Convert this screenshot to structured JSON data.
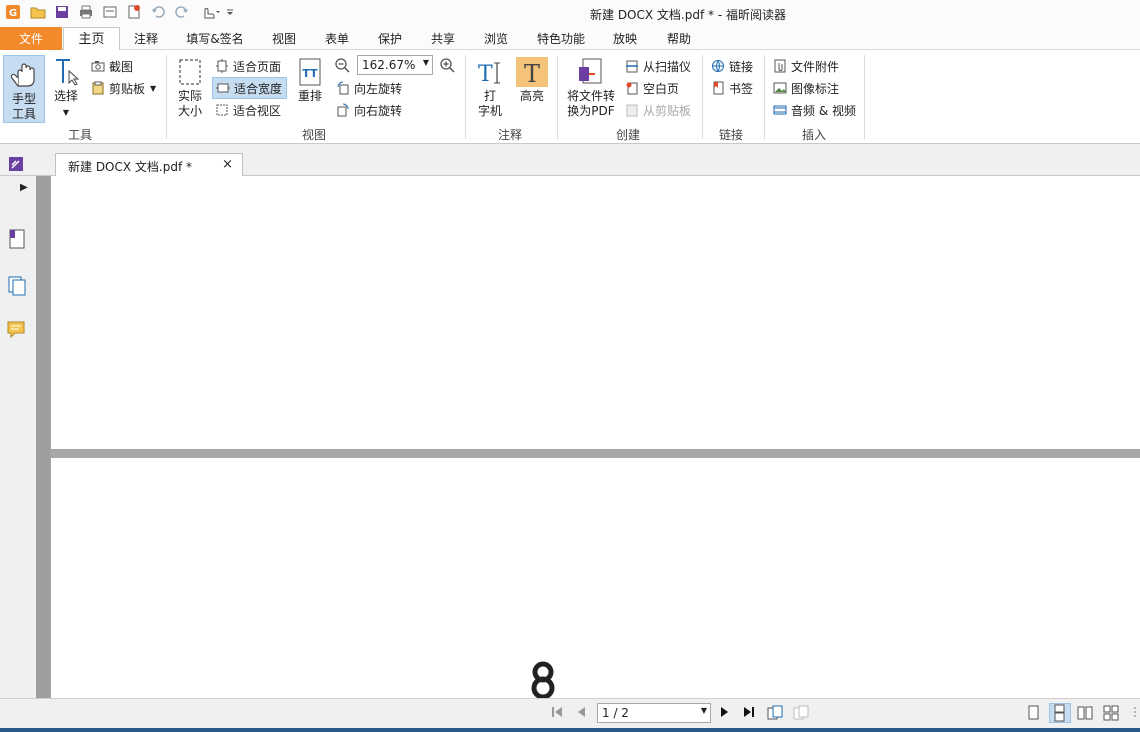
{
  "window": {
    "title": "新建 DOCX 文档.pdf * - 福昕阅读器"
  },
  "menubar": {
    "file": "文件",
    "home": "主页",
    "items": [
      "注释",
      "填写&签名",
      "视图",
      "表单",
      "保护",
      "共享",
      "浏览",
      "特色功能",
      "放映",
      "帮助"
    ]
  },
  "ribbon": {
    "tools": {
      "hand_tool": "手型工具",
      "hand_line1": "手型",
      "hand_line2": "工具",
      "select": "选择",
      "screenshot": "截图",
      "clipboard": "剪贴板",
      "group_label": "工具"
    },
    "view": {
      "actual_size_line1": "实际",
      "actual_size_line2": "大小",
      "fit_page": "适合页面",
      "fit_width": "适合宽度",
      "fit_visible": "适合视区",
      "reflow": "重排",
      "zoom_value": "162.67%",
      "rotate_left": "向左旋转",
      "rotate_right": "向右旋转",
      "group_label": "视图"
    },
    "annotate": {
      "typewriter_line1": "打",
      "typewriter_line2": "字机",
      "highlight": "高亮",
      "group_label": "注释"
    },
    "create": {
      "convert_line1": "将文件转",
      "convert_line2": "换为PDF",
      "from_scanner": "从扫描仪",
      "blank_page": "空白页",
      "from_clipboard": "从剪贴板",
      "group_label": "创建"
    },
    "links": {
      "link": "链接",
      "bookmark": "书签",
      "group_label": "链接"
    },
    "insert": {
      "file_attachment": "文件附件",
      "image_annotation": "图像标注",
      "audio_video": "音频 & 视频",
      "group_label": "插入"
    }
  },
  "document_tab": {
    "title": "新建 DOCX 文档.pdf *",
    "close": "×"
  },
  "statusbar": {
    "page_indicator": "1 / 2"
  },
  "colors": {
    "accent_orange": "#f28a2b",
    "active_blue": "#c6dcf0",
    "highlight_orange": "#f5c27a"
  }
}
